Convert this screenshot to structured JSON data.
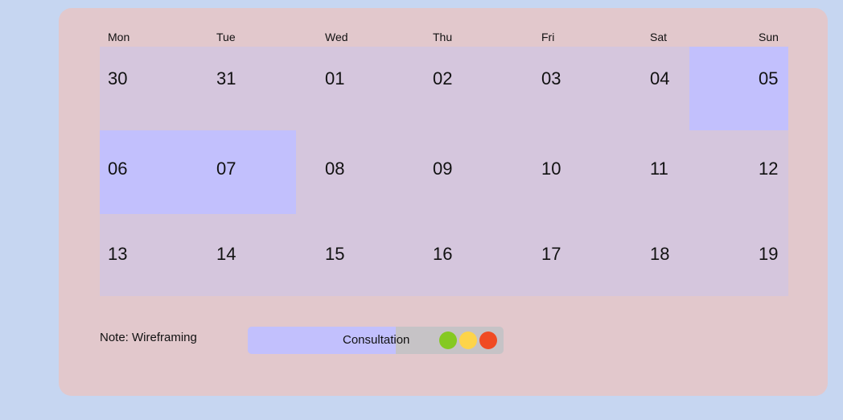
{
  "weekdays": [
    "Mon",
    "Tue",
    "Wed",
    "Thu",
    "Fri",
    "Sat",
    "Sun"
  ],
  "weeks": [
    [
      "30",
      "31",
      "01",
      "02",
      "03",
      "04",
      "05"
    ],
    [
      "06",
      "07",
      "08",
      "09",
      "10",
      "11",
      "12"
    ],
    [
      "13",
      "14",
      "15",
      "16",
      "17",
      "18",
      "19"
    ]
  ],
  "highlighted_days": [
    "05",
    "06",
    "07"
  ],
  "note": "Note: Wireframing",
  "status": {
    "label": "Consultation",
    "progress": 0.58,
    "dots": [
      {
        "name": "green",
        "color": "#85c922"
      },
      {
        "name": "yellow",
        "color": "#fdd44a"
      },
      {
        "name": "red",
        "color": "#f04b23"
      }
    ]
  },
  "colors": {
    "background": "#c6d6f1",
    "card": "#e2c8cc",
    "grid": "#d5c6dd",
    "highlight": "#c2c0fd",
    "status_track": "#c6c3c6"
  }
}
